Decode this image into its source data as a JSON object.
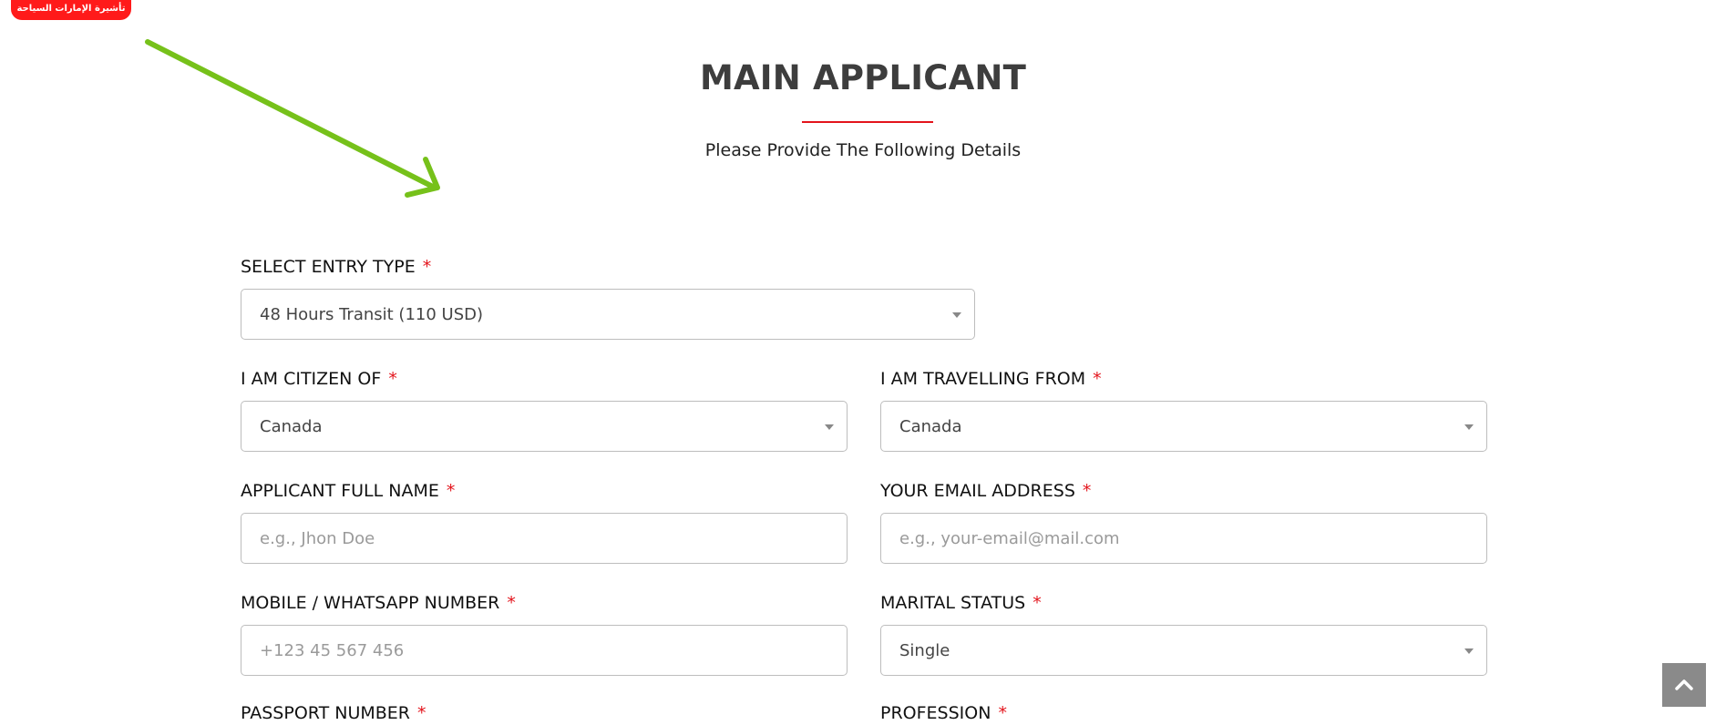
{
  "brand": {
    "badge_text": "تأشيرة الإمارات السياحة"
  },
  "header": {
    "title": "MAIN APPLICANT",
    "subtitle": "Please Provide The Following Details"
  },
  "form": {
    "entry_type": {
      "label": "SELECT ENTRY TYPE",
      "required": "*",
      "value": "48 Hours Transit (110 USD)"
    },
    "citizen_of": {
      "label": "I AM CITIZEN OF",
      "required": "*",
      "value": "Canada"
    },
    "travelling_from": {
      "label": "I AM TRAVELLING FROM",
      "required": "*",
      "value": "Canada"
    },
    "full_name": {
      "label": "APPLICANT FULL NAME",
      "required": "*",
      "placeholder": "e.g., Jhon Doe"
    },
    "email": {
      "label": "YOUR EMAIL ADDRESS",
      "required": "*",
      "placeholder": "e.g., your-email@mail.com"
    },
    "mobile": {
      "label": "MOBILE / WHATSAPP NUMBER",
      "required": "*",
      "placeholder": "+123 45 567 456"
    },
    "marital_status": {
      "label": "MARITAL STATUS",
      "required": "*",
      "value": "Single"
    },
    "passport": {
      "label": "PASSPORT NUMBER",
      "required": "*"
    },
    "profession": {
      "label": "PROFESSION",
      "required": "*"
    }
  },
  "colors": {
    "brand_red": "#ff1a1a",
    "accent_red": "#e3141c",
    "arrow_green": "#76c11a",
    "scroll_button": "#8a8a8a"
  },
  "icons": {
    "arrow": "arrow-annotation-icon",
    "caret": "caret-down-icon",
    "scroll_top": "chevron-up-icon"
  }
}
